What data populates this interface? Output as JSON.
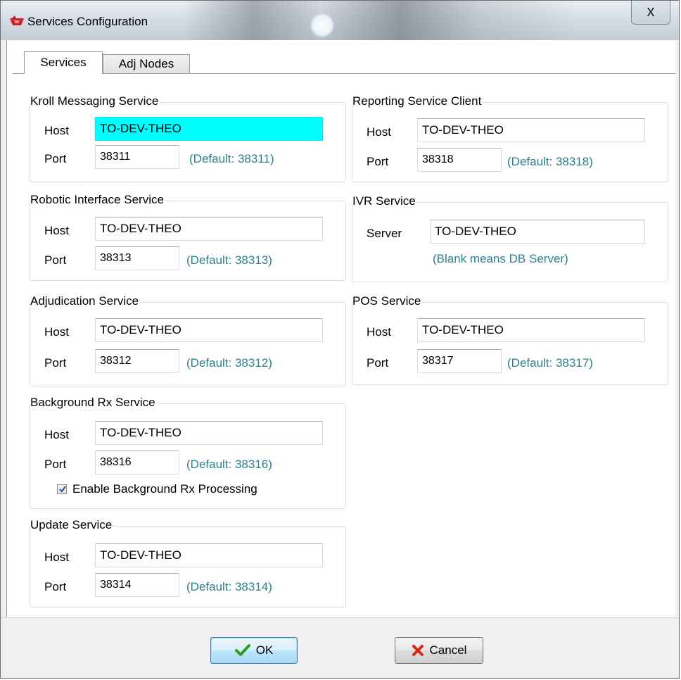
{
  "window": {
    "title": "Services Configuration",
    "close_label": "x"
  },
  "tabs": [
    {
      "label": "Services",
      "active": true
    },
    {
      "label": "Adj Nodes",
      "active": false
    }
  ],
  "groups": {
    "kroll": {
      "title": "Kroll Messaging Service",
      "host_label": "Host",
      "host": "TO-DEV-THEO",
      "port_label": "Port",
      "port": "38311",
      "default": "(Default: 38311)"
    },
    "robotic": {
      "title": "Robotic Interface Service",
      "host_label": "Host",
      "host": "TO-DEV-THEO",
      "port_label": "Port",
      "port": "38313",
      "default": "(Default: 38313)"
    },
    "adjudication": {
      "title": "Adjudication Service",
      "host_label": "Host",
      "host": "TO-DEV-THEO",
      "port_label": "Port",
      "port": "38312",
      "default": "(Default: 38312)"
    },
    "background": {
      "title": "Background Rx Service",
      "host_label": "Host",
      "host": "TO-DEV-THEO",
      "port_label": "Port",
      "port": "38316",
      "default": "(Default: 38316)",
      "checkbox_label": "Enable Background Rx Processing",
      "checked": true
    },
    "update": {
      "title": "Update Service",
      "host_label": "Host",
      "host": "TO-DEV-THEO",
      "port_label": "Port",
      "port": "38314",
      "default": "(Default: 38314)"
    },
    "reporting": {
      "title": "Reporting Service Client",
      "host_label": "Host",
      "host": "TO-DEV-THEO",
      "port_label": "Port",
      "port": "38318",
      "default": "(Default: 38318)"
    },
    "ivr": {
      "title": "IVR Service",
      "server_label": "Server",
      "server": "TO-DEV-THEO",
      "hint": "(Blank means DB Server)"
    },
    "pos": {
      "title": "POS Service",
      "host_label": "Host",
      "host": "TO-DEV-THEO",
      "port_label": "Port",
      "port": "38317",
      "default": "(Default: 38317)"
    }
  },
  "buttons": {
    "ok": "OK",
    "cancel": "Cancel"
  },
  "colors": {
    "hint_text": "#2c7f8c",
    "highlight_field": "#00ffff",
    "ok_check": "#2e9a23",
    "cancel_x": "#d42a1b"
  },
  "icons": {
    "app": "app-logo-icon",
    "ok": "checkmark-icon",
    "cancel": "x-mark-icon"
  }
}
